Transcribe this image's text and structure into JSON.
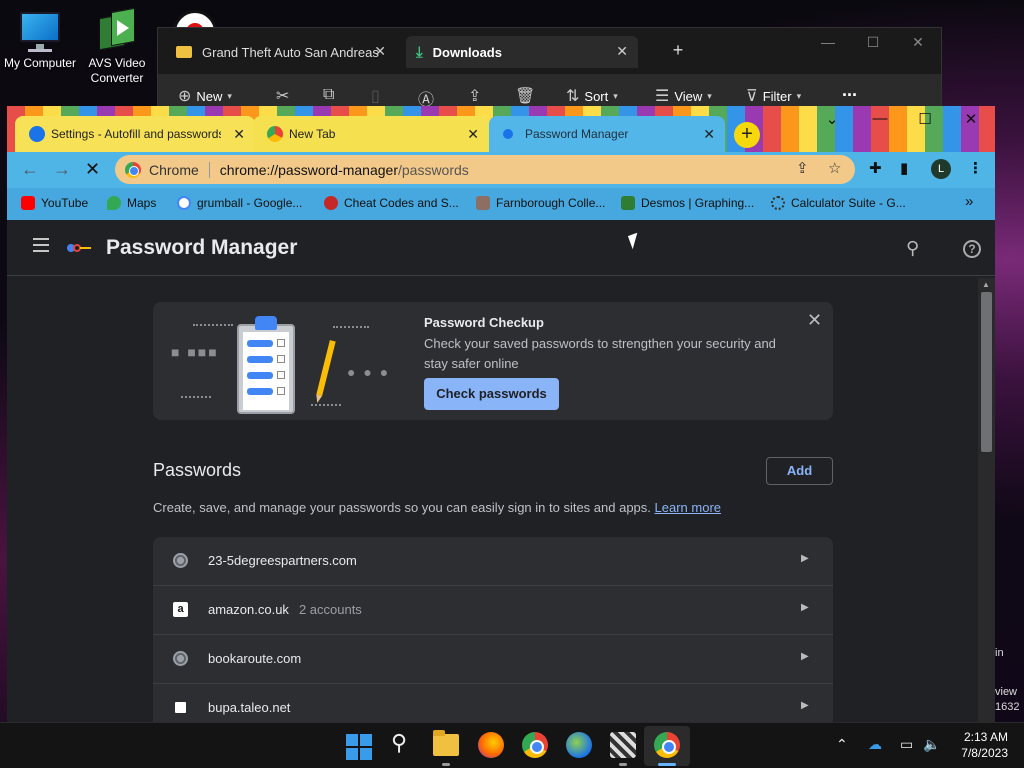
{
  "desktop": {
    "icons": [
      {
        "label": "My Computer"
      },
      {
        "label": "AVS Video Converter"
      }
    ]
  },
  "explorer": {
    "tabs": [
      {
        "label": "Grand Theft Auto San Andreas"
      },
      {
        "label": "Downloads"
      }
    ],
    "toolbar": {
      "new": "New",
      "sort": "Sort",
      "view": "View",
      "filter": "Filter",
      "more": "..."
    }
  },
  "chrome": {
    "tabs": [
      {
        "label": "Settings - Autofill and passwords"
      },
      {
        "label": "New Tab"
      },
      {
        "label": "Password Manager"
      }
    ],
    "omnibox": {
      "site": "Chrome",
      "url_host": "chrome://password-manager",
      "url_path": "/passwords"
    },
    "profile_initial": "L",
    "bookmarks": [
      {
        "label": "YouTube",
        "color": "#ff0000"
      },
      {
        "label": "Maps",
        "color": "#34a853"
      },
      {
        "label": "grumball - Google...",
        "color": "#4285f4"
      },
      {
        "label": "Cheat Codes and S...",
        "color": "#c62828"
      },
      {
        "label": "Farnborough Colle...",
        "color": "#8d6e63"
      },
      {
        "label": "Desmos | Graphing...",
        "color": "#2e7d32"
      },
      {
        "label": "Calculator Suite - G...",
        "color": "#9e9e9e"
      }
    ],
    "bookmarks_more": "»"
  },
  "page": {
    "title": "Password Manager",
    "checkup": {
      "title": "Password Checkup",
      "description": "Check your saved passwords to strengthen your security and stay safer online",
      "button": "Check passwords"
    },
    "passwords": {
      "heading": "Passwords",
      "add_label": "Add",
      "description": "Create, save, and manage your passwords so you can easily sign in to sites and apps.",
      "learn_more": "Learn more",
      "items": [
        {
          "site": "23-5degreespartners.com",
          "accounts": ""
        },
        {
          "site": "amazon.co.uk",
          "accounts": "2 accounts"
        },
        {
          "site": "bookaroute.com",
          "accounts": ""
        },
        {
          "site": "bupa.taleo.net",
          "accounts": ""
        }
      ]
    }
  },
  "edge_fragments": {
    "a": "in",
    "b": "view",
    "c": "1632"
  },
  "taskbar": {
    "time": "2:13 AM",
    "date": "7/8/2023"
  }
}
